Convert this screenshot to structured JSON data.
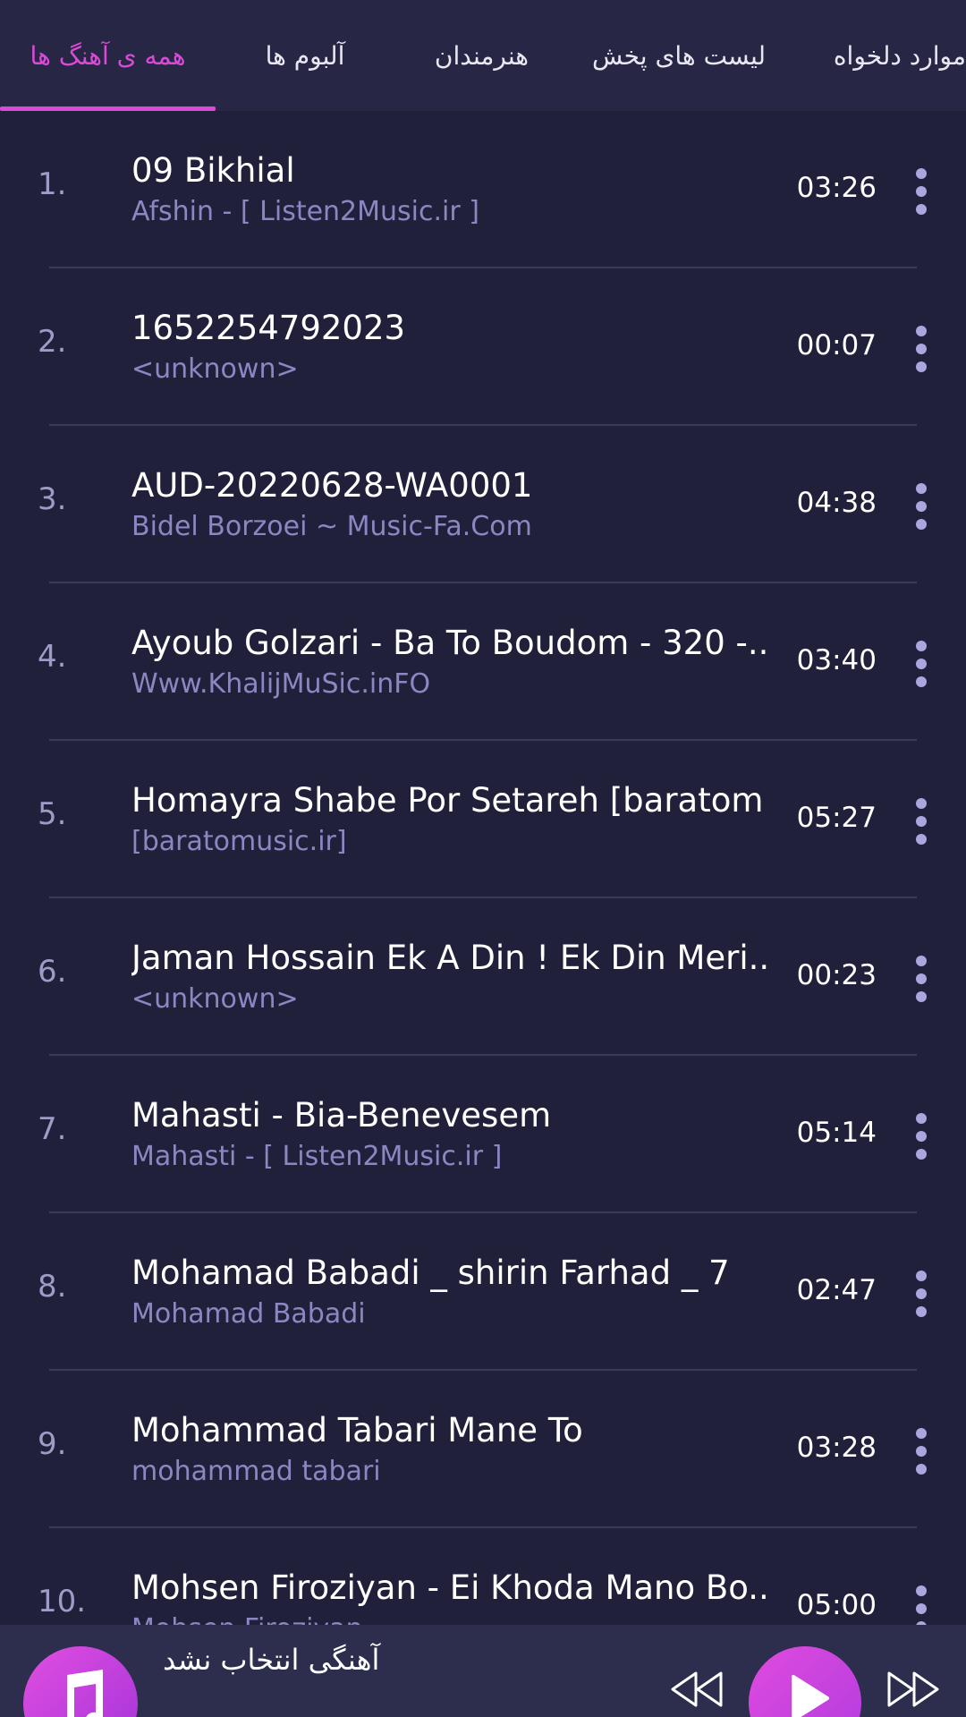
{
  "tabs": [
    {
      "label": "همه ی آهنگ ها",
      "active": true
    },
    {
      "label": "آلبوم ها",
      "active": false
    },
    {
      "label": "هنرمندان",
      "active": false
    },
    {
      "label": "لیست های پخش",
      "active": false
    },
    {
      "label": "موارد دلخواه",
      "active": false
    }
  ],
  "tracks": [
    {
      "num": "1.",
      "title": "09 Bikhial",
      "artist": "Afshin - [ Listen2Music.ir ]",
      "duration": "03:26"
    },
    {
      "num": "2.",
      "title": "1652254792023",
      "artist": "<unknown>",
      "duration": "00:07"
    },
    {
      "num": "3.",
      "title": "AUD-20220628-WA0001",
      "artist": "Bidel Borzoei ~ Music-Fa.Com",
      "duration": "04:38"
    },
    {
      "num": "4.",
      "title": "Ayoub Golzari - Ba To Boudom - 320 -...",
      "artist": "Www.KhalijMuSic.inFO",
      "duration": "03:40"
    },
    {
      "num": "5.",
      "title": "Homayra Shabe Por Setareh [baratom...",
      "artist": "[baratomusic.ir]",
      "duration": "05:27"
    },
    {
      "num": "6.",
      "title": "Jaman Hossain Ek A Din ! Ek Din Meri...",
      "artist": "<unknown>",
      "duration": "00:23"
    },
    {
      "num": "7.",
      "title": "Mahasti - Bia-Benevesem",
      "artist": "Mahasti - [ Listen2Music.ir ]",
      "duration": "05:14"
    },
    {
      "num": "8.",
      "title": "Mohamad Babadi _ shirin Farhad _ 7",
      "artist": "Mohamad Babadi",
      "duration": "02:47"
    },
    {
      "num": "9.",
      "title": "Mohammad Tabari Mane To",
      "artist": "mohammad tabari",
      "duration": "03:28"
    },
    {
      "num": "10.",
      "title": "Mohsen Firoziyan - Ei Khoda Mano Bo...",
      "artist": "Mohsen Firoziyan",
      "duration": "05:00"
    }
  ],
  "player": {
    "now_playing": "آهنگی انتخاب نشد",
    "icons": {
      "cover": "music-note-icon",
      "prev": "rewind-icon",
      "play": "play-icon",
      "next": "fast-forward-icon"
    }
  },
  "colors": {
    "background": "#20203a",
    "tabbar": "#272745",
    "accent": "#d94bd6",
    "secondary_text": "#8a87c2"
  }
}
